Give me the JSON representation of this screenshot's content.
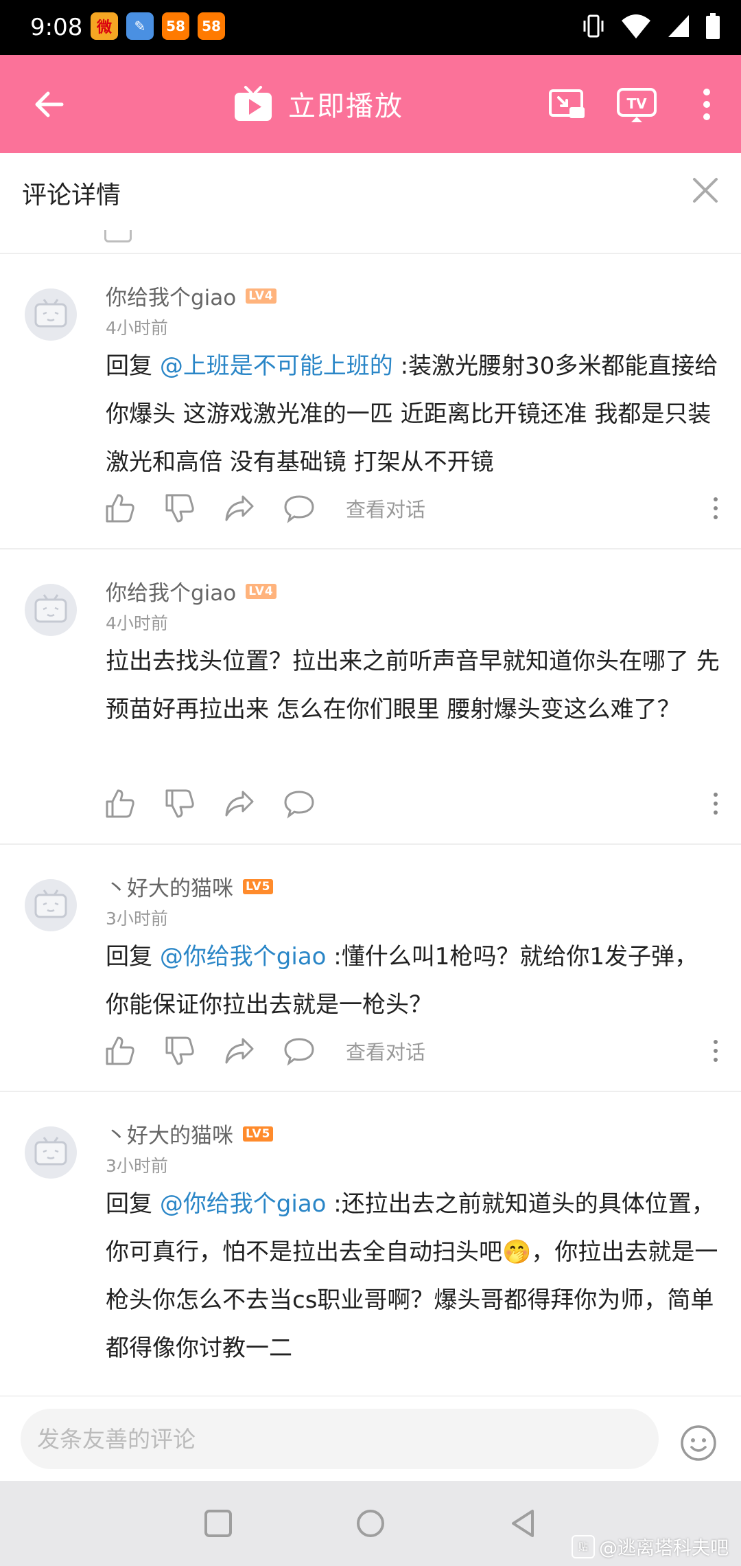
{
  "status_bar": {
    "time": "9:08",
    "notification_icons": [
      "weibo-icon",
      "cleaner-icon",
      "58-app-icon",
      "58-app-icon"
    ],
    "system_icons": [
      "vibrate-icon",
      "wifi-icon",
      "signal-icon",
      "battery-icon"
    ],
    "notif_labels": [
      "微",
      "✎",
      "58",
      "58"
    ]
  },
  "app_bar": {
    "play_now_label": "立即播放",
    "background_color": "#fb7299"
  },
  "detail_header": {
    "title": "评论详情"
  },
  "comments": [
    {
      "username": "你给我个giao",
      "level": "LV4",
      "time": "4小时前",
      "reply_prefix": "回复 ",
      "mention": "@上班是不可能上班的",
      "body": " :装激光腰射30多米都能直接给你爆头  这游戏激光准的一匹  近距离比开镜还准  我都是只装激光和高倍  没有基础镜  打架从不开镜",
      "view_conversation": "查看对话"
    },
    {
      "username": "你给我个giao",
      "level": "LV4",
      "time": "4小时前",
      "reply_prefix": "",
      "mention": "",
      "body": "拉出去找头位置？拉出来之前听声音早就知道你头在哪了  先预苗好再拉出来    怎么在你们眼里  腰射爆头变这么难了？",
      "view_conversation": ""
    },
    {
      "username": "丶好大的猫咪",
      "level": "LV5",
      "time": "3小时前",
      "reply_prefix": "回复 ",
      "mention": "@你给我个giao",
      "body": " :懂什么叫1枪吗？就给你1发子弹，你能保证你拉出去就是一枪头？",
      "view_conversation": "查看对话"
    },
    {
      "username": "丶好大的猫咪",
      "level": "LV5",
      "time": "3小时前",
      "reply_prefix": "回复 ",
      "mention": "@你给我个giao",
      "body": " :还拉出去之前就知道头的具体位置，你可真行，怕不是拉出去全自动扫头吧🤭，你拉出去就是一枪头你怎么不去当cs职业哥啊？爆头哥都得拜你为师，简单都得像你讨教一二",
      "view_conversation": ""
    }
  ],
  "input": {
    "placeholder": "发条友善的评论"
  },
  "watermark": {
    "text": "@逃离塔科夫吧",
    "logo": "贴"
  },
  "colors": {
    "accent": "#fb7299",
    "mention": "#2a86c7",
    "lv4": "#ffb37c",
    "lv5": "#ff8b2c"
  }
}
